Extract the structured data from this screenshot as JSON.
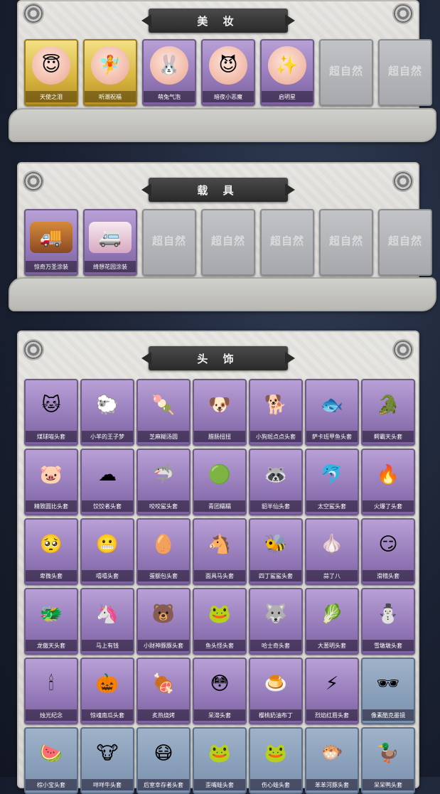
{
  "sections": {
    "makeup": {
      "title": "美 妆",
      "items": [
        {
          "name": "天使之泪",
          "style": "gold",
          "icon": "angel-face-icon",
          "glyph": "😇",
          "art": "face"
        },
        {
          "name": "听潮祝福",
          "style": "gold",
          "icon": "wing-face-icon",
          "glyph": "🧚",
          "art": "face"
        },
        {
          "name": "萌兔气泡",
          "style": "purple",
          "icon": "bunny-face-icon",
          "glyph": "🐰",
          "art": "face"
        },
        {
          "name": "暗夜小恶魔",
          "style": "purple",
          "icon": "devil-face-icon",
          "glyph": "😈",
          "art": "face"
        },
        {
          "name": "启明星",
          "style": "purple",
          "icon": "star-face-icon",
          "glyph": "✨",
          "art": "face"
        }
      ],
      "locked_count": 2
    },
    "vehicle": {
      "title": "载 具",
      "items": [
        {
          "name": "惊奇万圣涂装",
          "style": "purple",
          "icon": "halloween-truck-icon",
          "glyph": "🚚",
          "art": "truck"
        },
        {
          "name": "绮想花园涂装",
          "style": "purple",
          "icon": "garden-van-icon",
          "glyph": "🚐",
          "art": "van"
        }
      ],
      "locked_count": 5
    },
    "headwear": {
      "title": "头 饰",
      "items": [
        {
          "name": "煤球喵头套",
          "style": "purple",
          "icon": "cat-head-icon",
          "glyph": "🐱"
        },
        {
          "name": "小羊的王子梦",
          "style": "purple",
          "icon": "sheep-crown-icon",
          "glyph": "🐑"
        },
        {
          "name": "芝麻糊汤圆",
          "style": "purple",
          "icon": "dumpling-icon",
          "glyph": "🍡"
        },
        {
          "name": "腊肠扭扭",
          "style": "purple",
          "icon": "dog-head-icon",
          "glyph": "🐶"
        },
        {
          "name": "小狗斑点点头套",
          "style": "purple",
          "icon": "spotted-dog-icon",
          "glyph": "🐕"
        },
        {
          "name": "萨卡班甲鱼头套",
          "style": "purple",
          "icon": "fish-head-icon",
          "glyph": "🐟"
        },
        {
          "name": "鳄霸天头套",
          "style": "purple",
          "icon": "crocodile-head-icon",
          "glyph": "🐊"
        },
        {
          "name": "精致圆比头套",
          "style": "purple",
          "icon": "pink-round-icon",
          "glyph": "🐷"
        },
        {
          "name": "饺饺者头套",
          "style": "purple",
          "icon": "cloud-dumpling-icon",
          "glyph": "☁"
        },
        {
          "name": "咬咬鲨头套",
          "style": "purple",
          "icon": "shark-head-icon",
          "glyph": "🦈"
        },
        {
          "name": "青团糯糯",
          "style": "purple",
          "icon": "green-bun-icon",
          "glyph": "🟢"
        },
        {
          "name": "貂半仙头套",
          "style": "purple",
          "icon": "raccoon-head-icon",
          "glyph": "🦝"
        },
        {
          "name": "太空鲨头套",
          "style": "purple",
          "icon": "space-shark-icon",
          "glyph": "🐬"
        },
        {
          "name": "火爆了头套",
          "style": "purple",
          "icon": "fire-head-icon",
          "glyph": "🔥"
        },
        {
          "name": "卑微头套",
          "style": "purple",
          "icon": "shy-emoji-icon",
          "glyph": "🥺"
        },
        {
          "name": "嘻嘻头套",
          "style": "purple",
          "icon": "grin-emoji-icon",
          "glyph": "😬"
        },
        {
          "name": "蛋额包头套",
          "style": "purple",
          "icon": "egg-head-icon",
          "glyph": "🥚"
        },
        {
          "name": "面具马头套",
          "style": "purple",
          "icon": "horse-head-icon",
          "glyph": "🐴"
        },
        {
          "name": "四丁鲨鲨头套",
          "style": "purple",
          "icon": "bee-shark-icon",
          "glyph": "🐝"
        },
        {
          "name": "蒜了八",
          "style": "purple",
          "icon": "garlic-head-icon",
          "glyph": "🧄"
        },
        {
          "name": "滑稽头套",
          "style": "purple",
          "icon": "smirk-emoji-icon",
          "glyph": "😏"
        },
        {
          "name": "龙傲天头套",
          "style": "purple",
          "icon": "dragon-head-icon",
          "glyph": "🐲"
        },
        {
          "name": "马上有钱",
          "style": "purple",
          "icon": "pink-horse-icon",
          "glyph": "🦄"
        },
        {
          "name": "小财神豚豚头套",
          "style": "purple",
          "icon": "capybara-head-icon",
          "glyph": "🐻"
        },
        {
          "name": "鱼头怪头套",
          "style": "purple",
          "icon": "fishman-head-icon",
          "glyph": "🐸"
        },
        {
          "name": "哈士奇头套",
          "style": "purple",
          "icon": "husky-head-icon",
          "glyph": "🐺"
        },
        {
          "name": "大葱明头套",
          "style": "purple",
          "icon": "scallion-head-icon",
          "glyph": "🥬"
        },
        {
          "name": "雪墩墩头套",
          "style": "purple",
          "icon": "snowman-head-icon",
          "glyph": "⛄"
        },
        {
          "name": "烛光纪念",
          "style": "purple",
          "icon": "candle-head-icon",
          "glyph": "🕯"
        },
        {
          "name": "惊魂南瓜头套",
          "style": "purple",
          "icon": "pumpkin-head-icon",
          "glyph": "🎃"
        },
        {
          "name": "炙热烧烤",
          "style": "purple",
          "icon": "bbq-head-icon",
          "glyph": "🍖"
        },
        {
          "name": "呆滞头套",
          "style": "purple",
          "icon": "dazed-emoji-icon",
          "glyph": "😳"
        },
        {
          "name": "樱桃奶油布丁",
          "style": "purple",
          "icon": "pudding-head-icon",
          "glyph": "🍮"
        },
        {
          "name": "烈焰红唇头套",
          "style": "purple",
          "icon": "pikachu-head-icon",
          "glyph": "⚡"
        },
        {
          "name": "像素酷克墨镜",
          "style": "blue",
          "icon": "pixel-sunglasses-icon",
          "glyph": "🕶"
        },
        {
          "name": "棕小宝头套",
          "style": "blue",
          "icon": "watermelon-head-icon",
          "glyph": "🍉"
        },
        {
          "name": "咩咩牛头套",
          "style": "blue",
          "icon": "cow-head-icon",
          "glyph": "🐮"
        },
        {
          "name": "后室幸存者头套",
          "style": "blue",
          "icon": "gasmask-head-icon",
          "glyph": "😷"
        },
        {
          "name": "歪嘴蛙头套",
          "style": "blue",
          "icon": "frog-head-icon",
          "glyph": "🐸"
        },
        {
          "name": "伤心蛙头套",
          "style": "blue",
          "icon": "sad-frog-icon",
          "glyph": "🐸"
        },
        {
          "name": "苯苯河豚头套",
          "style": "blue",
          "icon": "pufferfish-head-icon",
          "glyph": "🐡"
        },
        {
          "name": "呆呆鸭头套",
          "style": "blue",
          "icon": "duck-head-icon",
          "glyph": "🦆"
        }
      ]
    }
  },
  "locked_logo": "超自然"
}
